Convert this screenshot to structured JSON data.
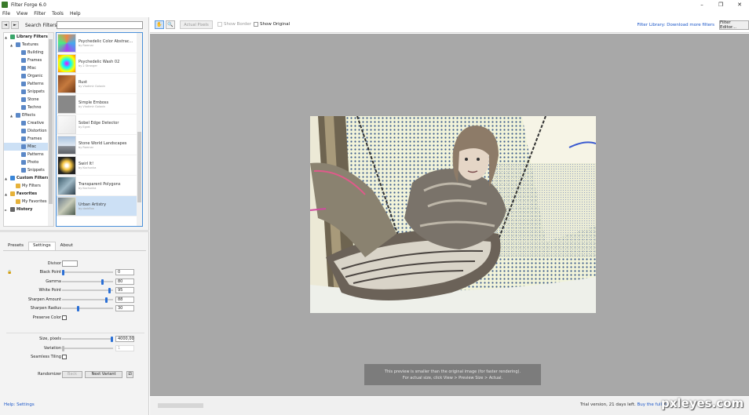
{
  "window": {
    "title": "Filter Forge 6.0",
    "minimize": "–",
    "restore": "❐",
    "close": "✕"
  },
  "menu": [
    "File",
    "View",
    "Filter",
    "Tools",
    "Help"
  ],
  "search": {
    "back": "◄",
    "forward": "►",
    "label": "Search Filters:",
    "value": ""
  },
  "tree": [
    {
      "label": "Library Filters",
      "level": 0,
      "expander": "▲",
      "color": "#3aa56a",
      "bold": true
    },
    {
      "label": "Textures",
      "level": 1,
      "expander": "▲",
      "color": "#5b88c7"
    },
    {
      "label": "Building",
      "level": 2,
      "color": "#5b88c7"
    },
    {
      "label": "Frames",
      "level": 2,
      "color": "#5b88c7"
    },
    {
      "label": "Misc",
      "level": 2,
      "color": "#5b88c7"
    },
    {
      "label": "Organic",
      "level": 2,
      "color": "#5b88c7"
    },
    {
      "label": "Patterns",
      "level": 2,
      "color": "#5b88c7"
    },
    {
      "label": "Snippets",
      "level": 2,
      "color": "#5b88c7"
    },
    {
      "label": "Stone",
      "level": 2,
      "color": "#5b88c7"
    },
    {
      "label": "Techno",
      "level": 2,
      "color": "#5b88c7"
    },
    {
      "label": "Effects",
      "level": 1,
      "expander": "▲",
      "color": "#5b88c7"
    },
    {
      "label": "Creative",
      "level": 2,
      "color": "#5b88c7"
    },
    {
      "label": "Distortion",
      "level": 2,
      "color": "#5b88c7"
    },
    {
      "label": "Frames",
      "level": 2,
      "color": "#5b88c7"
    },
    {
      "label": "Misc",
      "level": 2,
      "color": "#5b88c7",
      "selected": true
    },
    {
      "label": "Patterns",
      "level": 2,
      "color": "#5b88c7"
    },
    {
      "label": "Photo",
      "level": 2,
      "color": "#5b88c7"
    },
    {
      "label": "Snippets",
      "level": 2,
      "color": "#5b88c7"
    },
    {
      "label": "Custom Filters",
      "level": 0,
      "expander": "▲",
      "color": "#3a86d8",
      "bold": true
    },
    {
      "label": "My Filters",
      "level": 1,
      "color": "#e6b23a"
    },
    {
      "label": "Favorites",
      "level": 0,
      "expander": "▲",
      "color": "#e6b23a",
      "bold": true
    },
    {
      "label": "My Favorites",
      "level": 1,
      "color": "#e6b23a"
    },
    {
      "label": "History",
      "level": 0,
      "expander": "►",
      "color": "#666",
      "bold": true
    }
  ],
  "filters": [
    {
      "name": "Psychedelic Color Abstrac...",
      "author": "by Ramnar",
      "thumb": "conic-gradient(#e84,#4ae,#a4e,#4e8,#e84)"
    },
    {
      "name": "Psychedelic Wash 02",
      "author": "by 2 Stranger",
      "thumb": "radial-gradient(circle,#f0f,#0ff,#ff0,#f80)"
    },
    {
      "name": "Rust",
      "author": "by Vladimir Golovin",
      "thumb": "linear-gradient(135deg,#8a4a22,#c67a3e,#6b3515)"
    },
    {
      "name": "Simple Emboss",
      "author": "by Vladimir Golovin",
      "thumb": "linear-gradient(#888,#888)"
    },
    {
      "name": "Sobel Edge Detector",
      "author": "by Egret",
      "thumb": "linear-gradient(135deg,#fafafa,#e8e8e8)"
    },
    {
      "name": "Stone World Landscapes",
      "author": "by Ramnar",
      "thumb": "linear-gradient(#aac4e0,#dfe8f1 55%,#8a8f96 56%,#5c6067)"
    },
    {
      "name": "Swirl It!",
      "author": "by Kochunka",
      "thumb": "radial-gradient(circle,#fff 10%,#f5c542 35%,#222 70%)"
    },
    {
      "name": "Transparent Polygons",
      "author": "by Kochunka",
      "thumb": "linear-gradient(135deg,#3a5a6a,#9fb9c6,#2c3e4a)"
    },
    {
      "name": "Urban Artistry",
      "author": "by darkfloa",
      "thumb": "linear-gradient(135deg,#6a7a8a,#c7cbb8,#4a5a4e)",
      "selected": true
    }
  ],
  "tabs": [
    {
      "label": "Presets"
    },
    {
      "label": "Settings",
      "active": true
    },
    {
      "label": "About"
    }
  ],
  "params": {
    "divisor": {
      "label": "Divisor"
    },
    "black_point": {
      "label": "Black Point",
      "value": "0",
      "level": 0.0
    },
    "gamma": {
      "label": "Gamma",
      "value": "80",
      "level": 0.8
    },
    "white_point": {
      "label": "White Point",
      "value": "95",
      "level": 0.95
    },
    "sharpen_amount": {
      "label": "Sharpen Amount",
      "value": "88",
      "level": 0.88
    },
    "sharpen_radius": {
      "label": "Sharpen Radius",
      "value": "30",
      "level": 0.3
    },
    "preserve_color": {
      "label": "Preserve Color"
    },
    "size": {
      "label": "Size, pixels",
      "value": "4000,00",
      "level": 1.0
    },
    "variation": {
      "label": "Variation",
      "value": "1",
      "level": 0.0
    },
    "seamless": {
      "label": "Seamless Tiling"
    },
    "randomizer": {
      "label": "Randomizer",
      "back": "Back",
      "next": "Next Variant",
      "dice": "⚂"
    }
  },
  "lock_icon": "🔒",
  "help": "Help: Settings",
  "toolbar": {
    "hand": "✋",
    "zoom": "🔍",
    "actual_pixels": "Actual Pixels",
    "show_border": "Show Border",
    "show_original": "Show Original",
    "library_link": "Filter Library: Download more filters",
    "editor": "Filter Editor..."
  },
  "preview": {
    "message_line1": "This preview is smaller than the original image (for faster rendering).",
    "message_line2": "For actual size, click View > Preview Size > Actual."
  },
  "status": {
    "trial": "Trial version, 21 days left.",
    "buy": "Buy the full ve"
  },
  "watermark": "pxleyes.com"
}
